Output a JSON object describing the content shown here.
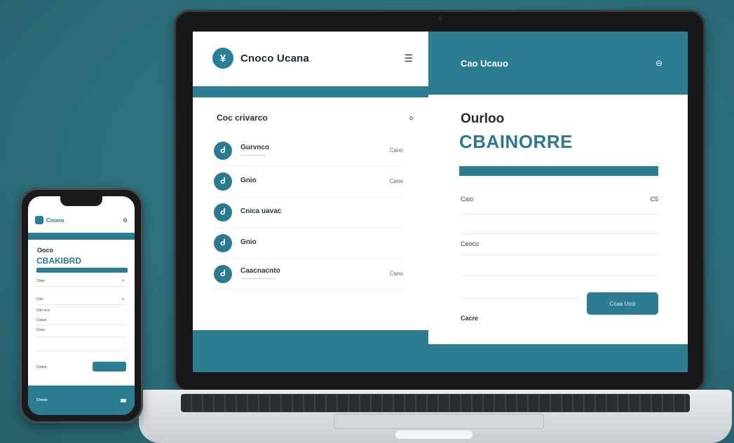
{
  "laptop": {
    "left_panel": {
      "logo_glyph": "¥",
      "title": "Cnoco Ucana",
      "menu_icon": "hamburger-icon",
      "section_title": "Coc crivarco",
      "section_dot": "o",
      "rows": [
        {
          "glyph": "Ꮷ",
          "name": "Gurvnco",
          "sub": "—————",
          "value": "Cano"
        },
        {
          "glyph": "Ꮷ",
          "name": "Gnio",
          "sub": "",
          "value": "Cano"
        },
        {
          "glyph": "Ꮷ",
          "name": "Cnica uavac",
          "sub": "",
          "value": ""
        },
        {
          "glyph": "Ꮷ",
          "name": "Gnio",
          "sub": "",
          "value": ""
        },
        {
          "glyph": "Ꮷ",
          "name": "Caacnacnto",
          "sub": "———————",
          "value": "Cano"
        }
      ]
    },
    "right_panel": {
      "title": "Cao Ucauo",
      "header_icon": "circle-icon",
      "kicker": "Ourloo",
      "heading": "CBAINORRE",
      "field1_label": "Cxio",
      "field1_value": "C5",
      "field2_label": "Ceoco",
      "button_label": "Ccaa Ucoi",
      "bottom_label": "Cacre"
    }
  },
  "phone": {
    "title": "Cnono",
    "header_icon": "settings-icon",
    "kicker": "Ooco",
    "heading": "CBAKIBRD",
    "field_labels": [
      "Cnoo",
      "Ciro",
      "Cao oco",
      "Cnoco",
      "Cnoo",
      "Cnono"
    ],
    "field_dots": [
      "o",
      "o"
    ],
    "footer_label": "Cnnoo"
  }
}
